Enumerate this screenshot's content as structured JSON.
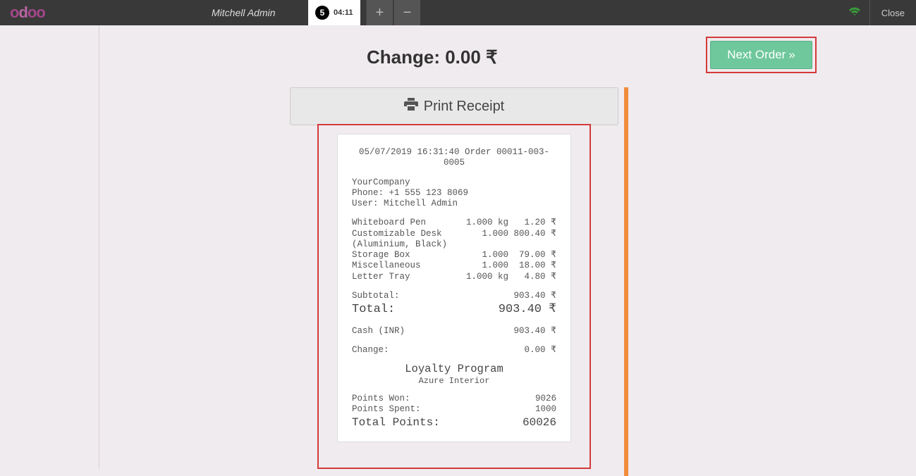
{
  "header": {
    "logo_text": "odoo",
    "username": "Mitchell Admin",
    "tab_badge": "5",
    "tab_time": "04:11",
    "close_label": "Close"
  },
  "change_line": "Change: 0.00 ₹",
  "next_order_label": "Next Order",
  "print_label": "Print Receipt",
  "receipt": {
    "order_line": "05/07/2019 16:31:40 Order 00011-003-0005",
    "company": "YourCompany",
    "phone_label": "Phone:",
    "phone": "+1 555 123 8069",
    "user_label": "User:",
    "user": "Mitchell Admin",
    "items": [
      {
        "name": "Whiteboard Pen",
        "qty": "1.000 kg",
        "price": "1.20 ₹"
      },
      {
        "name": "Customizable Desk (Aluminium, Black)",
        "qty": "1.000",
        "price": "800.40 ₹"
      },
      {
        "name": "Storage Box",
        "qty": "1.000",
        "price": "79.00 ₹"
      },
      {
        "name": "Miscellaneous",
        "qty": "1.000",
        "price": "18.00 ₹"
      },
      {
        "name": "Letter Tray",
        "qty": "1.000 kg",
        "price": "4.80 ₹"
      }
    ],
    "subtotal_label": "Subtotal:",
    "subtotal": "903.40 ₹",
    "total_label": "Total:",
    "total": "903.40 ₹",
    "cash_label": "Cash (INR)",
    "cash": "903.40 ₹",
    "change_label": "Change:",
    "change": "0.00 ₹",
    "loyalty_title": "Loyalty Program",
    "loyalty_subtitle": "Azure Interior",
    "points_won_label": "Points Won:",
    "points_won": "9026",
    "points_spent_label": "Points Spent:",
    "points_spent": "1000",
    "total_points_label": "Total Points:",
    "total_points": "60026"
  }
}
